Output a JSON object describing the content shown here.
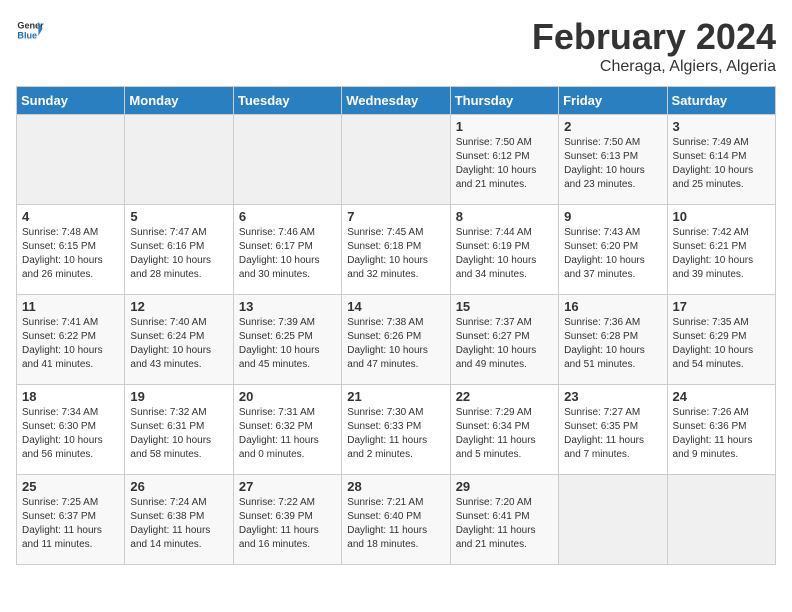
{
  "logo": {
    "text_general": "General",
    "text_blue": "Blue"
  },
  "title": {
    "month_year": "February 2024",
    "location": "Cheraga, Algiers, Algeria"
  },
  "weekdays": [
    "Sunday",
    "Monday",
    "Tuesday",
    "Wednesday",
    "Thursday",
    "Friday",
    "Saturday"
  ],
  "weeks": [
    [
      {
        "day": "",
        "info": ""
      },
      {
        "day": "",
        "info": ""
      },
      {
        "day": "",
        "info": ""
      },
      {
        "day": "",
        "info": ""
      },
      {
        "day": "1",
        "info": "Sunrise: 7:50 AM\nSunset: 6:12 PM\nDaylight: 10 hours\nand 21 minutes."
      },
      {
        "day": "2",
        "info": "Sunrise: 7:50 AM\nSunset: 6:13 PM\nDaylight: 10 hours\nand 23 minutes."
      },
      {
        "day": "3",
        "info": "Sunrise: 7:49 AM\nSunset: 6:14 PM\nDaylight: 10 hours\nand 25 minutes."
      }
    ],
    [
      {
        "day": "4",
        "info": "Sunrise: 7:48 AM\nSunset: 6:15 PM\nDaylight: 10 hours\nand 26 minutes."
      },
      {
        "day": "5",
        "info": "Sunrise: 7:47 AM\nSunset: 6:16 PM\nDaylight: 10 hours\nand 28 minutes."
      },
      {
        "day": "6",
        "info": "Sunrise: 7:46 AM\nSunset: 6:17 PM\nDaylight: 10 hours\nand 30 minutes."
      },
      {
        "day": "7",
        "info": "Sunrise: 7:45 AM\nSunset: 6:18 PM\nDaylight: 10 hours\nand 32 minutes."
      },
      {
        "day": "8",
        "info": "Sunrise: 7:44 AM\nSunset: 6:19 PM\nDaylight: 10 hours\nand 34 minutes."
      },
      {
        "day": "9",
        "info": "Sunrise: 7:43 AM\nSunset: 6:20 PM\nDaylight: 10 hours\nand 37 minutes."
      },
      {
        "day": "10",
        "info": "Sunrise: 7:42 AM\nSunset: 6:21 PM\nDaylight: 10 hours\nand 39 minutes."
      }
    ],
    [
      {
        "day": "11",
        "info": "Sunrise: 7:41 AM\nSunset: 6:22 PM\nDaylight: 10 hours\nand 41 minutes."
      },
      {
        "day": "12",
        "info": "Sunrise: 7:40 AM\nSunset: 6:24 PM\nDaylight: 10 hours\nand 43 minutes."
      },
      {
        "day": "13",
        "info": "Sunrise: 7:39 AM\nSunset: 6:25 PM\nDaylight: 10 hours\nand 45 minutes."
      },
      {
        "day": "14",
        "info": "Sunrise: 7:38 AM\nSunset: 6:26 PM\nDaylight: 10 hours\nand 47 minutes."
      },
      {
        "day": "15",
        "info": "Sunrise: 7:37 AM\nSunset: 6:27 PM\nDaylight: 10 hours\nand 49 minutes."
      },
      {
        "day": "16",
        "info": "Sunrise: 7:36 AM\nSunset: 6:28 PM\nDaylight: 10 hours\nand 51 minutes."
      },
      {
        "day": "17",
        "info": "Sunrise: 7:35 AM\nSunset: 6:29 PM\nDaylight: 10 hours\nand 54 minutes."
      }
    ],
    [
      {
        "day": "18",
        "info": "Sunrise: 7:34 AM\nSunset: 6:30 PM\nDaylight: 10 hours\nand 56 minutes."
      },
      {
        "day": "19",
        "info": "Sunrise: 7:32 AM\nSunset: 6:31 PM\nDaylight: 10 hours\nand 58 minutes."
      },
      {
        "day": "20",
        "info": "Sunrise: 7:31 AM\nSunset: 6:32 PM\nDaylight: 11 hours\nand 0 minutes."
      },
      {
        "day": "21",
        "info": "Sunrise: 7:30 AM\nSunset: 6:33 PM\nDaylight: 11 hours\nand 2 minutes."
      },
      {
        "day": "22",
        "info": "Sunrise: 7:29 AM\nSunset: 6:34 PM\nDaylight: 11 hours\nand 5 minutes."
      },
      {
        "day": "23",
        "info": "Sunrise: 7:27 AM\nSunset: 6:35 PM\nDaylight: 11 hours\nand 7 minutes."
      },
      {
        "day": "24",
        "info": "Sunrise: 7:26 AM\nSunset: 6:36 PM\nDaylight: 11 hours\nand 9 minutes."
      }
    ],
    [
      {
        "day": "25",
        "info": "Sunrise: 7:25 AM\nSunset: 6:37 PM\nDaylight: 11 hours\nand 11 minutes."
      },
      {
        "day": "26",
        "info": "Sunrise: 7:24 AM\nSunset: 6:38 PM\nDaylight: 11 hours\nand 14 minutes."
      },
      {
        "day": "27",
        "info": "Sunrise: 7:22 AM\nSunset: 6:39 PM\nDaylight: 11 hours\nand 16 minutes."
      },
      {
        "day": "28",
        "info": "Sunrise: 7:21 AM\nSunset: 6:40 PM\nDaylight: 11 hours\nand 18 minutes."
      },
      {
        "day": "29",
        "info": "Sunrise: 7:20 AM\nSunset: 6:41 PM\nDaylight: 11 hours\nand 21 minutes."
      },
      {
        "day": "",
        "info": ""
      },
      {
        "day": "",
        "info": ""
      }
    ]
  ]
}
